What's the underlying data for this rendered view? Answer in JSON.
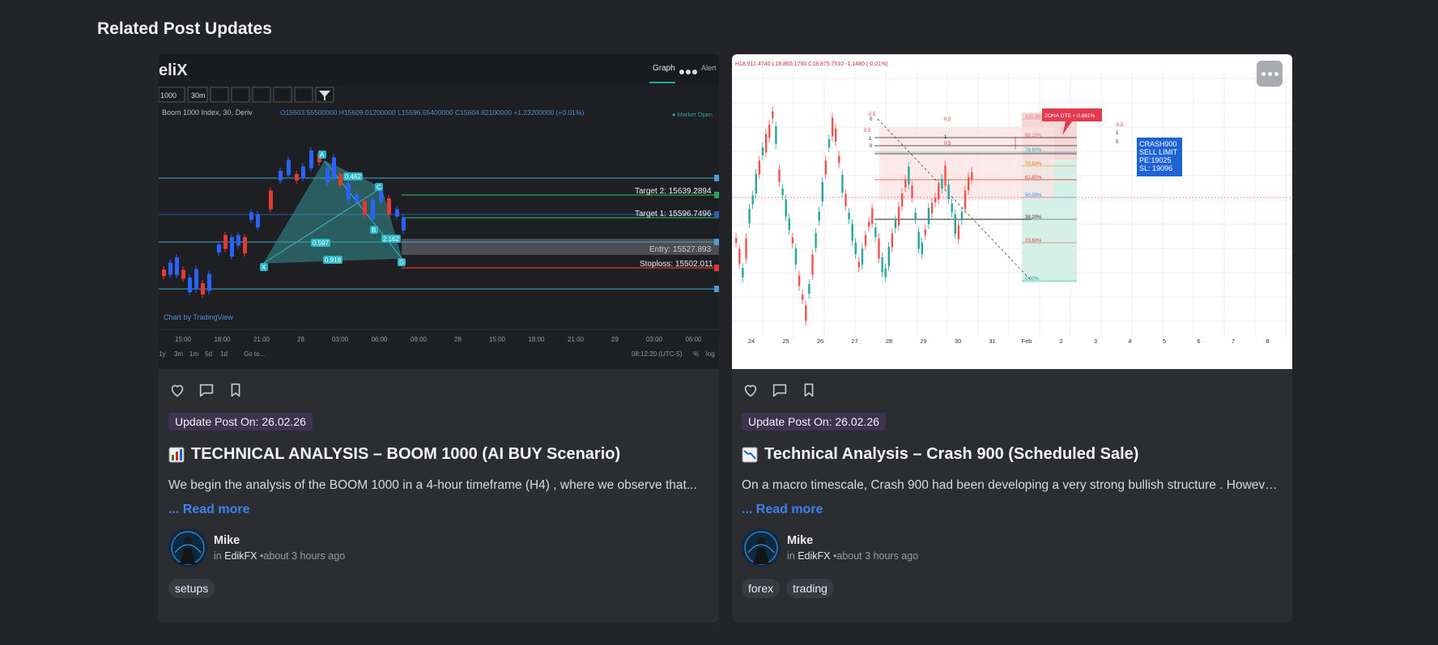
{
  "section": {
    "title": "Related Post Updates"
  },
  "posts": [
    {
      "badge": "Update Post On: 26.02.26",
      "title": "TECHNICAL ANALYSIS – BOOM 1000 (AI BUY Scenario)",
      "excerpt": "We begin the analysis of the BOOM 1000 in a 4-hour timeframe (H4) , where we observe that...",
      "read_more": "... Read more",
      "author": {
        "name": "Mike",
        "in": "in",
        "group": "EdikFX",
        "time": "•about 3 hours ago"
      },
      "tags": [
        "setups"
      ],
      "thumb": {
        "logo": "eliX",
        "tab_graph": "Graph",
        "tab_alerts": "Alert",
        "symbol_box": "1000",
        "tf_box": "30m",
        "symbol_line": "Boom 1000 Index, 30, Deriv",
        "ohlc": "O15603.55500000  H15609.01200000  L15596.55400000  C15604.82100000  +1.23200000 (+0.01%)",
        "market": "● Market Open",
        "target2": "Target 2: 15639.2894",
        "target1": "Target 1: 15596.7496",
        "entry": "Entry: 15527.893",
        "stoploss": "Stoploss: 15502.011",
        "credit": "Chart by TradingView",
        "time_labels": [
          "15:00",
          "18:00",
          "21:00",
          "28",
          "03:00",
          "06:00",
          "09:00",
          "28",
          "15:00",
          "18:00",
          "21:00",
          "29",
          "03:00",
          "06:00"
        ],
        "ranges": [
          "1y",
          "3m",
          "1m",
          "5d",
          "1d",
          "Go to..."
        ],
        "clock": "08:12:20 (UTC-5)",
        "pct": "%",
        "log": "log",
        "pattern": {
          "a": "A",
          "b": "B",
          "c": "C",
          "d": "D",
          "x": "X",
          "r1": "0.462",
          "r2": "0.597",
          "r3": "0.918",
          "r4": "2.162"
        }
      }
    },
    {
      "badge": "Update Post On: 26.02.26",
      "title": "Technical Analysis – Crash 900 (Scheduled Sale)",
      "excerpt": "On a macro timescale, Crash 900 had been developing a very strong bullish structure . However, ...",
      "read_more": "... Read more",
      "author": {
        "name": "Mike",
        "in": "in",
        "group": "EdikFX",
        "time": "•about 3 hours ago"
      },
      "tags": [
        "forex",
        "trading"
      ],
      "thumb": {
        "ohlc": "H18,911.4740  L18,865.1760  C18,875.7510  -1.1480 (-0.01%)",
        "zone": "ZONA OTE + 0.881%",
        "box": [
          "CRASH900",
          "SELL LIMIT",
          "PE:19025",
          "SL: 19096"
        ],
        "fib": [
          "100.00%",
          "88.10%",
          "78.60%",
          "70.50%",
          "61.80%",
          "50.00%",
          "38.20%",
          "23.60%",
          "0.00%"
        ],
        "small": [
          "0",
          "0.5",
          "1",
          "0",
          "0.5",
          "0.5",
          "0.5",
          "1",
          "0",
          "0.5",
          "1"
        ],
        "dates": [
          "24",
          "25",
          "26",
          "27",
          "28",
          "29",
          "30",
          "31",
          "Feb",
          "2",
          "3",
          "4",
          "5",
          "6",
          "7",
          "8"
        ]
      }
    }
  ],
  "colors": {
    "accent": "#3b82f6",
    "badge_bg": "#3d3550",
    "card_bg": "#2c2d31",
    "page_bg": "#232428"
  },
  "icons": [
    "heart-icon",
    "comment-icon",
    "bookmark-icon",
    "more-options-icon",
    "chart-up-emoji-icon",
    "chart-down-emoji-icon"
  ]
}
